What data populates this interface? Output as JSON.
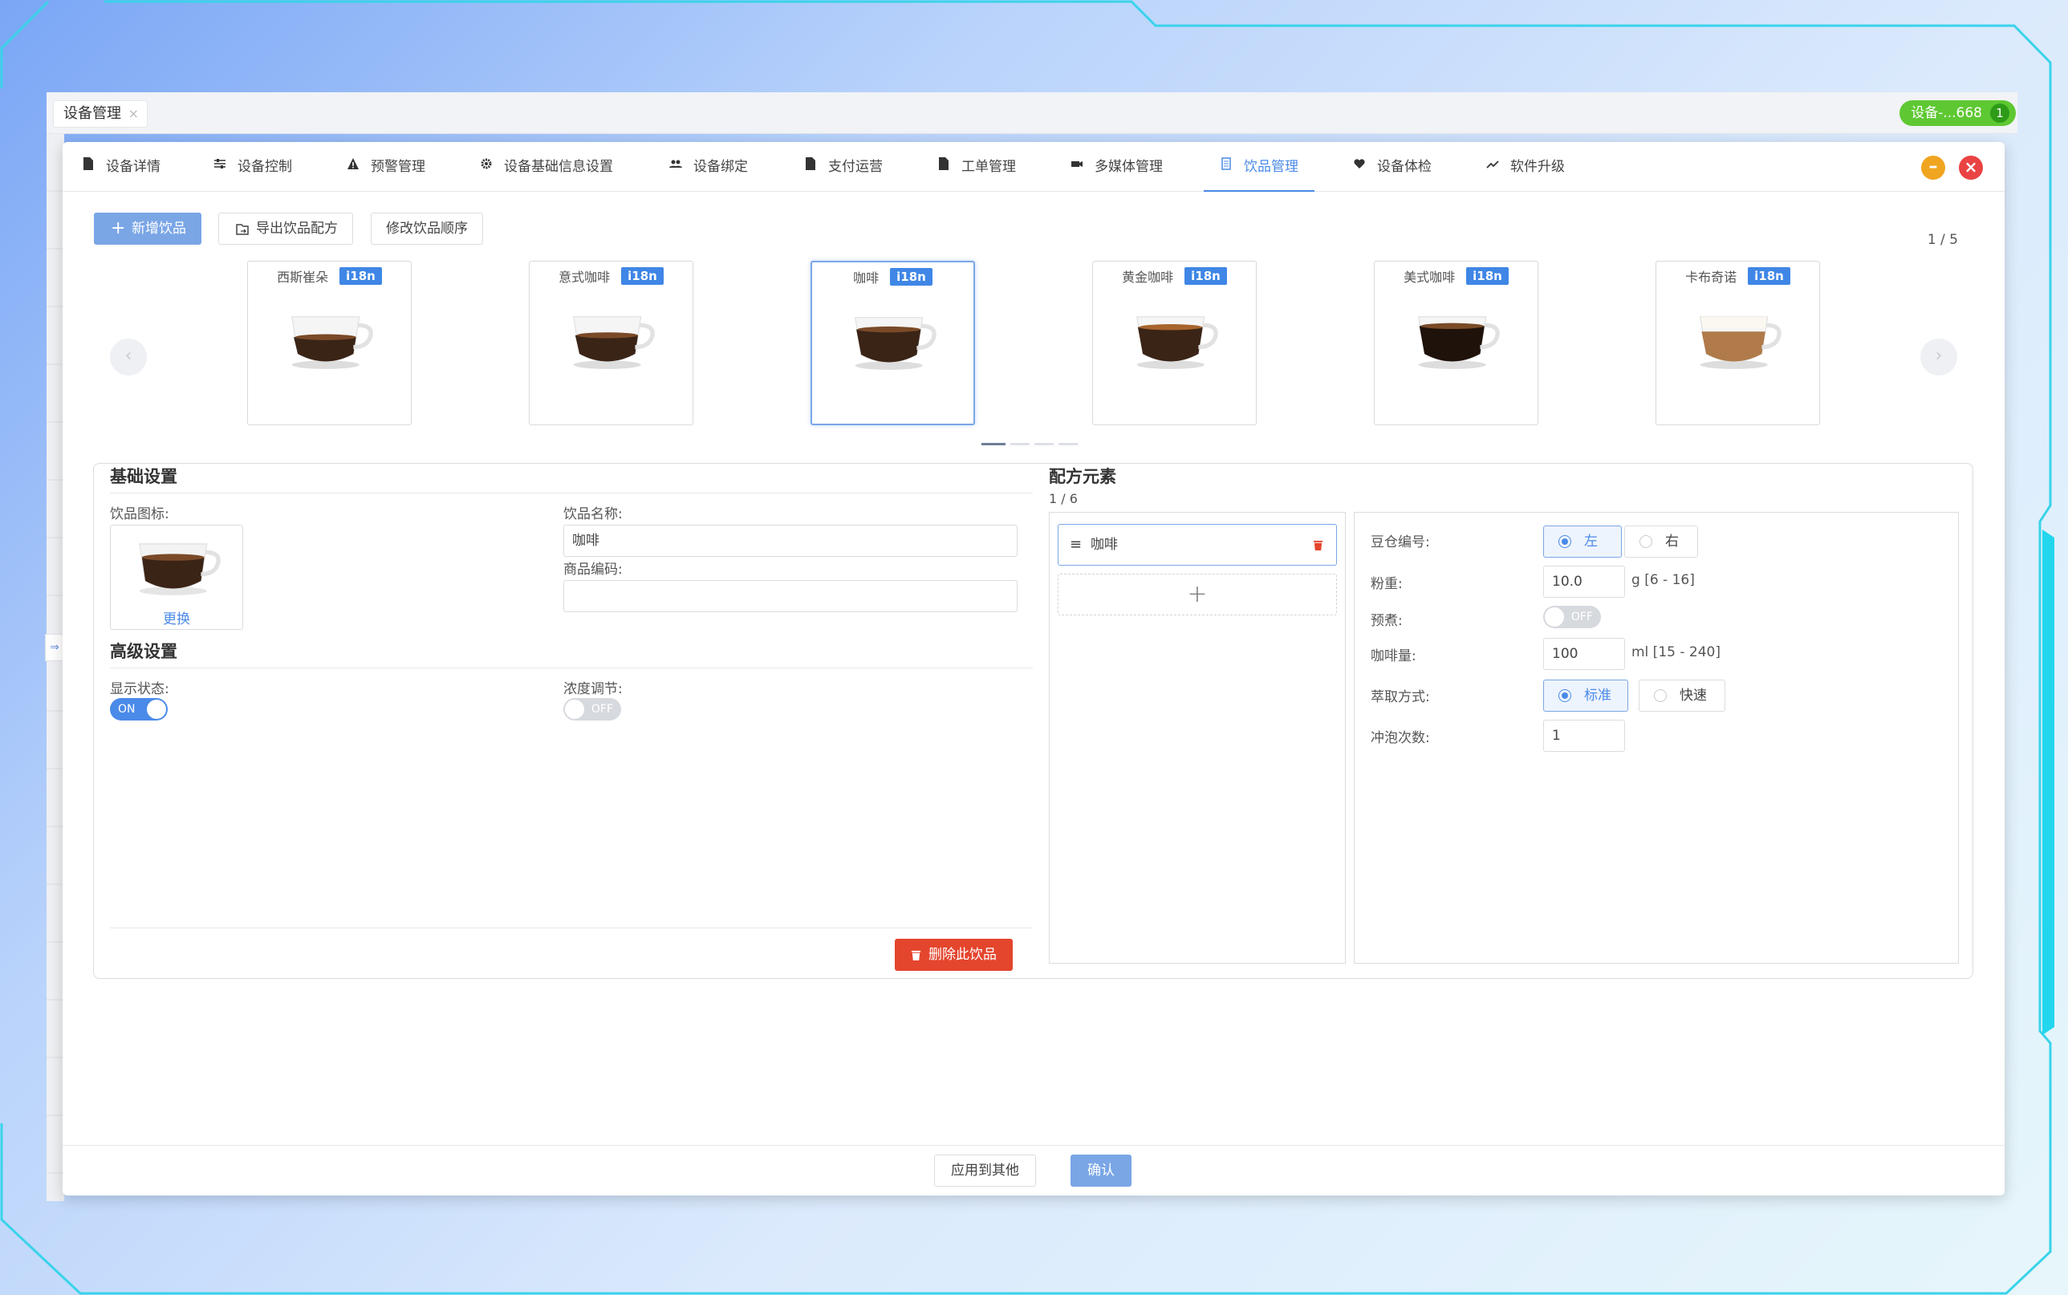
{
  "outer": {
    "tab_label": "设备管理",
    "tab_close": "×",
    "device_badge": "设备-...668",
    "device_count": "1"
  },
  "tabs": [
    {
      "label": "设备详情",
      "icon": "file-icon"
    },
    {
      "label": "设备控制",
      "icon": "sliders-icon"
    },
    {
      "label": "预警管理",
      "icon": "warning-icon"
    },
    {
      "label": "设备基础信息设置",
      "icon": "gear-icon"
    },
    {
      "label": "设备绑定",
      "icon": "users-icon"
    },
    {
      "label": "支付运营",
      "icon": "file-icon"
    },
    {
      "label": "工单管理",
      "icon": "file-icon"
    },
    {
      "label": "多媒体管理",
      "icon": "video-icon"
    },
    {
      "label": "饮品管理",
      "icon": "document-icon",
      "active": true
    },
    {
      "label": "设备体检",
      "icon": "heart-icon"
    },
    {
      "label": "软件升级",
      "icon": "trend-icon"
    }
  ],
  "window": {
    "minimize": "–",
    "close": "×"
  },
  "toolbar": {
    "add_drink": "新增饮品",
    "export_recipe": "导出饮品配方",
    "edit_order": "修改饮品顺序"
  },
  "carousel": {
    "page": "1 / 5",
    "prev": "‹",
    "next": "›",
    "tag": "i18n",
    "drinks": [
      {
        "name": "西斯崔朵"
      },
      {
        "name": "意式咖啡"
      },
      {
        "name": "咖啡"
      },
      {
        "name": "黄金咖啡"
      },
      {
        "name": "美式咖啡"
      },
      {
        "name": "卡布奇诺"
      }
    ]
  },
  "basic": {
    "title": "基础设置",
    "icon_label": "饮品图标:",
    "replace": "更换",
    "name_label": "饮品名称:",
    "name_value": "咖啡",
    "code_label": "商品编码:",
    "code_value": ""
  },
  "advanced": {
    "title": "高级设置",
    "display_label": "显示状态:",
    "display_state": "ON",
    "strength_label": "浓度调节:",
    "strength_state": "OFF"
  },
  "delete_button": "删除此饮品",
  "recipe": {
    "title": "配方元素",
    "count": "1 / 6",
    "item": "咖啡",
    "add": "+",
    "bean_label": "豆仓编号:",
    "bean_left": "左",
    "bean_right": "右",
    "powder_label": "粉重:",
    "powder_value": "10.0",
    "powder_unit": "g [6 - 16]",
    "preinfuse_label": "预煮:",
    "preinfuse_state": "OFF",
    "coffee_label": "咖啡量:",
    "coffee_value": "100",
    "coffee_unit": "ml [15 - 240]",
    "extract_label": "萃取方式:",
    "extract_standard": "标准",
    "extract_fast": "快速",
    "brew_label": "冲泡次数:",
    "brew_value": "1"
  },
  "footer": {
    "apply_others": "应用到其他",
    "confirm": "确认"
  },
  "colors": {
    "primary": "#4a8ae8",
    "danger": "#e4452d",
    "success": "#5ec832",
    "warning": "#f0a521"
  }
}
